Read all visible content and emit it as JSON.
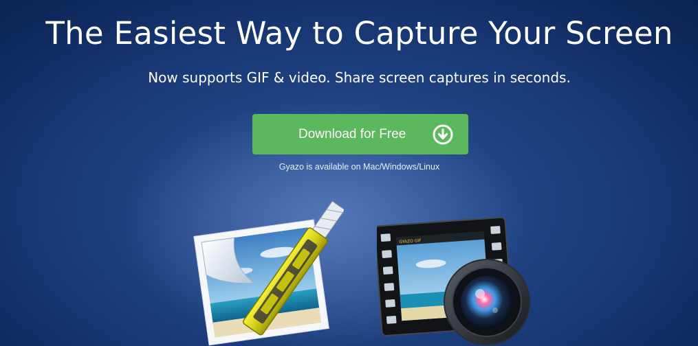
{
  "hero": {
    "headline": "The Easiest Way to Capture Your Screen",
    "subline": "Now supports GIF & video. Share screen captures in seconds.",
    "download_label": "Download for Free",
    "download_icon": "download-circle-arrow",
    "availability": "Gyazo is available on Mac/Windows/Linux"
  },
  "illustrations": {
    "image_icon": "image-capture-cutter-icon",
    "video_icon": "video-capture-camera-icon",
    "video_top_bar": "GYAZO GIF"
  },
  "colors": {
    "background_dark": "#081a45",
    "background_mid": "#2d5597",
    "button_green": "#5cb85c",
    "text": "#ffffff"
  }
}
